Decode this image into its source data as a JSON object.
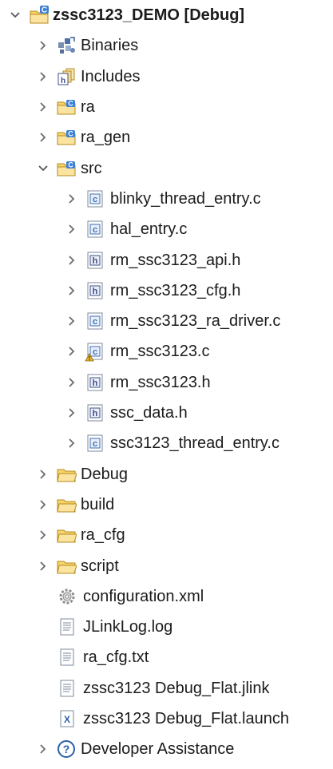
{
  "project_explorer": {
    "root": {
      "label": "zssc3123_DEMO [Debug]",
      "expanded": true,
      "icon": "c-project-icon"
    },
    "items": [
      {
        "label": "Binaries",
        "icon": "binaries-icon",
        "expanded": false
      },
      {
        "label": "Includes",
        "icon": "includes-icon",
        "expanded": false
      },
      {
        "label": "ra",
        "icon": "source-folder-icon",
        "expanded": false
      },
      {
        "label": "ra_gen",
        "icon": "source-folder-icon",
        "expanded": false
      },
      {
        "label": "src",
        "icon": "source-folder-icon",
        "expanded": true
      },
      {
        "label": "blinky_thread_entry.c",
        "icon": "c-file-icon",
        "expanded": false
      },
      {
        "label": "hal_entry.c",
        "icon": "c-file-icon",
        "expanded": false
      },
      {
        "label": "rm_ssc3123_api.h",
        "icon": "h-file-icon",
        "expanded": false
      },
      {
        "label": "rm_ssc3123_cfg.h",
        "icon": "h-file-icon",
        "expanded": false
      },
      {
        "label": "rm_ssc3123_ra_driver.c",
        "icon": "c-file-icon",
        "expanded": false
      },
      {
        "label": "rm_ssc3123.c",
        "icon": "c-file-warning-icon",
        "expanded": false
      },
      {
        "label": "rm_ssc3123.h",
        "icon": "h-file-icon",
        "expanded": false
      },
      {
        "label": "ssc_data.h",
        "icon": "h-file-icon",
        "expanded": false
      },
      {
        "label": "ssc3123_thread_entry.c",
        "icon": "c-file-icon",
        "expanded": false
      },
      {
        "label": "Debug",
        "icon": "folder-icon",
        "expanded": false
      },
      {
        "label": "build",
        "icon": "folder-icon",
        "expanded": false
      },
      {
        "label": "ra_cfg",
        "icon": "folder-icon",
        "expanded": false
      },
      {
        "label": "script",
        "icon": "folder-icon",
        "expanded": false
      },
      {
        "label": "configuration.xml",
        "icon": "gear-file-icon"
      },
      {
        "label": "JLinkLog.log",
        "icon": "text-file-icon"
      },
      {
        "label": "ra_cfg.txt",
        "icon": "text-file-icon"
      },
      {
        "label": "zssc3123 Debug_Flat.jlink",
        "icon": "text-file-icon"
      },
      {
        "label": "zssc3123 Debug_Flat.launch",
        "icon": "launch-file-icon"
      },
      {
        "label": "Developer Assistance",
        "icon": "help-icon",
        "expanded": false
      }
    ]
  },
  "colors": {
    "folder_fill": "#f6d36b",
    "folder_stroke": "#b58b1e",
    "c_file_accent": "#3d6fb5",
    "h_file_accent": "#3d4f8a",
    "project_blue": "#3c7fd6",
    "warning_yellow": "#e9b531",
    "chevron": "#6b6b6b"
  }
}
